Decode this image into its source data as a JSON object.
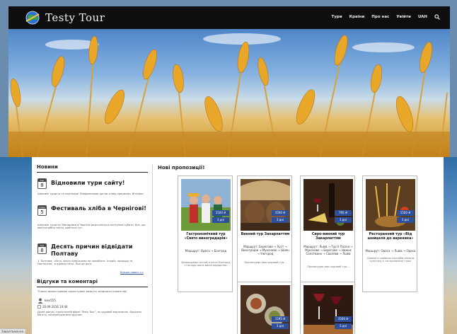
{
  "site": {
    "logo_text": "Testy Tour",
    "nav": [
      "Тури",
      "Країни",
      "Про нас",
      "Увійти",
      "UAH"
    ],
    "colors": {
      "header_bg": "#0e0e0e",
      "accent": "#2d4f9c"
    }
  },
  "sidebar": {
    "news_heading": "Новини",
    "news": [
      {
        "month": "Sep",
        "day": "8",
        "title": "Відновили тури сайту!",
        "body": "Шановні туристи та партнери! Повідомляємо що ми знову працюємо. Вітаємо!"
      },
      {
        "month": "Травн",
        "day": "5",
        "title": "Фестиваль хліба в Чернігові!",
        "body": "Шановні туристи! Мандрівка в Чернігів розпочнеться наступної суботи. Все, що вам потрібно знати, дивіться тут."
      },
      {
        "month": "Sep",
        "day": "8",
        "title": "Десять причин відвідати Полтаву",
        "body": "1. Полтава - місто, якого неможливо не полюбити. Історія, природа та мистецтво - в одному місці. Про це далі.",
        "more": "Більше новин >>"
      }
    ],
    "reviews_heading": "Відгуки та коментарі",
    "reviews_note": "Тільки зареєстровані користувачі можуть залишати коментарі",
    "review": {
      "author": "kiev555",
      "date": "26.09.2016 19:44",
      "text": "Дуже дякую, туристичній фірмі \"Testy Tour\", за чудовий відпочинок. Вражень багато, рекомендую всім друзям."
    }
  },
  "main": {
    "heading": "Нові пропозиції!",
    "cards": [
      {
        "title": "Гастрономічний тур «Свято виноградарів»",
        "price": "1500 ₴",
        "days": "3 дні",
        "route": "Маршрут: Одеса → Болград",
        "desc": "Запрошуємо гостей в місто Болград, з нагоди свята виноградарства."
      },
      {
        "title": "Винний тур Закарпаттям",
        "price": "1500 ₴",
        "days": "3 дні",
        "route": "Маршрут: Берегове → Хуст → Виноградів → Мукачево → Шаян → Ужгород",
        "desc": "Пропонуємо вам чудовий тур..."
      },
      {
        "title": "Сиро-винний тур Закарпаттям",
        "price": "795 ₴",
        "days": "3 дні",
        "route": "Маршрут: Львів → Тур'я Пасіка → Мукачево → Берегове → Нижнє Солотвино → Свалява → Львів",
        "desc": "Пропонуємо вам чудовий тур..."
      },
      {
        "title": "Ресторанний тур «Від шницеля до вареника»",
        "price": "1500 ₴",
        "days": "3 дні",
        "route": "Маршрут: Одеса → Львів → Одеса",
        "desc": "Одним із чарівних способів пізнати культуру є гастрономічні тури."
      },
      {
        "title": "",
        "price": "1595 ₴",
        "days": "3 дні",
        "route": "",
        "desc": ""
      },
      {
        "title": "",
        "price": "1500 ₴",
        "days": "3 дні",
        "route": "",
        "desc": ""
      }
    ]
  },
  "status_text": "Завантаження..."
}
